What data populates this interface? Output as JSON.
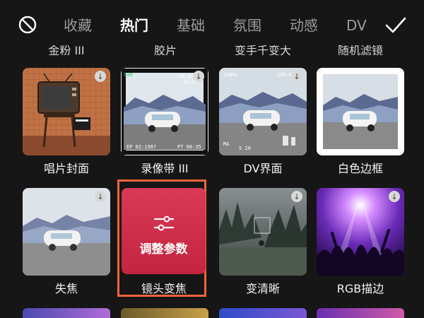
{
  "topbar": {
    "none_icon": "none-circle-slash-icon",
    "confirm_icon": "checkmark-icon",
    "tabs": [
      {
        "label": "收藏",
        "active": false
      },
      {
        "label": "热门",
        "active": true
      },
      {
        "label": "基础",
        "active": false
      },
      {
        "label": "氛围",
        "active": false
      },
      {
        "label": "动感",
        "active": false
      },
      {
        "label": "DV",
        "active": false
      }
    ]
  },
  "partial_row": {
    "labels": [
      "金粉 III",
      "胶片",
      "变手千变大",
      "随机滤镜"
    ]
  },
  "effects_row1": [
    {
      "label": "唱片封面",
      "icon": "tv-icon",
      "download_icon": "download-icon",
      "osd": []
    },
    {
      "label": "录像带 III",
      "icon": "vhs-icon",
      "download_icon": "download-icon",
      "osd": [
        "CAM",
        "-00:00:00",
        "-99:99",
        "PM",
        "EP 02:1987",
        "PT 00:35"
      ]
    },
    {
      "label": "DV界面",
      "icon": "dv-icon",
      "download_icon": "download-icon",
      "osd": [
        "1280x",
        "100-6",
        "MA",
        "5 20"
      ]
    },
    {
      "label": "白色边框",
      "icon": "white-frame-icon",
      "download_icon": "download-icon",
      "osd": []
    }
  ],
  "effects_row2": [
    {
      "label": "失焦",
      "icon": "blur-icon",
      "download_icon": "download-icon"
    },
    {
      "label": "镜头变焦",
      "icon": "sliders-icon",
      "overlay_text": "调整参数",
      "selected": true
    },
    {
      "label": "变清晰",
      "icon": "sharpen-icon",
      "download_icon": "download-icon"
    },
    {
      "label": "RGB描边",
      "icon": "rgb-stroke-icon",
      "download_icon": "download-icon"
    }
  ],
  "colors": {
    "background": "#161616",
    "tab_inactive": "#9c9c9c",
    "tab_active": "#ffffff",
    "selection_frame": "#f2643a",
    "adjust_card": "#d33350"
  }
}
